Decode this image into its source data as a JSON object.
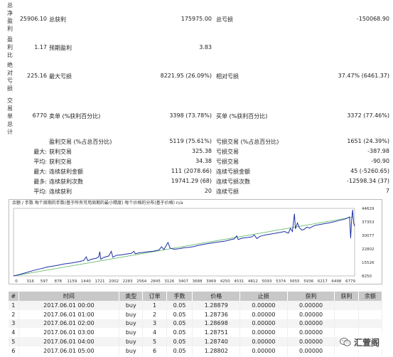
{
  "stats": {
    "net_profit": {
      "label_chars": [
        "总",
        "净",
        "盈",
        "利"
      ],
      "value": "25906.10"
    },
    "gross_profit": {
      "label": "总获利",
      "value": "175975.00"
    },
    "gross_loss": {
      "label": "总亏损",
      "value": "-150068.90"
    },
    "profit_factor": {
      "label_chars": [
        "盈",
        "利",
        "比"
      ],
      "value": "1.17"
    },
    "expected_payoff": {
      "label": "预期盈利",
      "value": "3.83"
    },
    "abs_drawdown": {
      "label_chars": [
        "绝",
        "对",
        "亏",
        "损"
      ],
      "value": "225.16"
    },
    "max_drawdown": {
      "label": "最大亏损",
      "value": "8221.95 (26.09%)"
    },
    "rel_drawdown": {
      "label": "相对亏损",
      "value": "37.47% (6461.37)"
    },
    "total_trades": {
      "label_chars": [
        "交",
        "易",
        "单",
        "总",
        "计"
      ],
      "value": "6770"
    },
    "short_positions": {
      "label": "卖单 (%获利百分比)",
      "value": "3398 (73.78%)"
    },
    "long_positions": {
      "label": "买单 (%获利百分比)",
      "value": "3372 (77.46%)"
    },
    "profit_trades": {
      "label": "盈利交易 (%占总百分比)",
      "value": "5119 (75.61%)"
    },
    "loss_trades": {
      "label": "亏损交易 (%占总百分比)",
      "value": "1651 (24.39%)"
    },
    "largest": {
      "prefix": "最大:",
      "profit_label": "获利交易",
      "profit_value": "325.38",
      "loss_label": "亏损交易",
      "loss_value": "-387.98"
    },
    "average": {
      "prefix": "平均:",
      "profit_label": "获利交易",
      "profit_value": "34.38",
      "loss_label": "亏损交易",
      "loss_value": "-90.90"
    },
    "max_consec": {
      "prefix": "最大:",
      "wins_label": "连续获利金额",
      "wins_value": "111 (2078.66)",
      "losses_label": "连续亏损金额",
      "losses_value": "45 (-5260.65)"
    },
    "most_consec": {
      "prefix": "最多:",
      "profit_label": "连续获利次数",
      "profit_value": "19741.29 (68)",
      "loss_label": "连续亏损次数",
      "loss_value": "-12598.34 (37)"
    },
    "avg_consec": {
      "prefix": "平均:",
      "wins_label": "连续获利",
      "wins_value": "20",
      "losses_label": "连续亏损",
      "losses_value": "7"
    }
  },
  "chart_header": "余额 / 手数   每个周期的手数(基于所有可用周期的最小精度)  每个价格的分布(基于价格)  n/a",
  "chart_data": {
    "type": "line",
    "series": [],
    "x_ticks": [
      "0",
      "316",
      "597",
      "878",
      "1159",
      "1440",
      "1721",
      "2002",
      "2283",
      "2564",
      "2845",
      "3126",
      "3407",
      "3688",
      "3969",
      "4250",
      "4531",
      "4812",
      "5093",
      "5374",
      "5655",
      "5936",
      "6217",
      "6498",
      "6779"
    ],
    "y_ticks": [
      "44629",
      "37353",
      "30077",
      "22802",
      "15526",
      "8250"
    ],
    "ylim": [
      8250,
      44629
    ],
    "xlim": [
      0,
      6800
    ],
    "points": [
      [
        0,
        8250
      ],
      [
        120,
        9000
      ],
      [
        250,
        10000
      ],
      [
        400,
        11200
      ],
      [
        550,
        12200
      ],
      [
        700,
        13200
      ],
      [
        850,
        13800
      ],
      [
        1000,
        14700
      ],
      [
        1150,
        15200
      ],
      [
        1300,
        15900
      ],
      [
        1400,
        16600
      ],
      [
        1450,
        18500
      ],
      [
        1480,
        16400
      ],
      [
        1550,
        17200
      ],
      [
        1650,
        17800
      ],
      [
        1700,
        18600
      ],
      [
        1720,
        21300
      ],
      [
        1740,
        17300
      ],
      [
        1800,
        18200
      ],
      [
        1900,
        19000
      ],
      [
        1950,
        21500
      ],
      [
        1980,
        18300
      ],
      [
        2050,
        19300
      ],
      [
        2150,
        19600
      ],
      [
        2250,
        20000
      ],
      [
        2350,
        20400
      ],
      [
        2400,
        21500
      ],
      [
        2430,
        20200
      ],
      [
        2500,
        20700
      ],
      [
        2600,
        21000
      ],
      [
        2700,
        21300
      ],
      [
        2800,
        21600
      ],
      [
        2900,
        22200
      ],
      [
        2950,
        23900
      ],
      [
        3000,
        22500
      ],
      [
        3080,
        26300
      ],
      [
        3120,
        23300
      ],
      [
        3200,
        22600
      ],
      [
        3300,
        22900
      ],
      [
        3400,
        23400
      ],
      [
        3500,
        23700
      ],
      [
        3600,
        24100
      ],
      [
        3700,
        24800
      ],
      [
        3800,
        25300
      ],
      [
        3900,
        25800
      ],
      [
        4000,
        26200
      ],
      [
        4100,
        26600
      ],
      [
        4200,
        26900
      ],
      [
        4300,
        27600
      ],
      [
        4400,
        28200
      ],
      [
        4450,
        29800
      ],
      [
        4480,
        27800
      ],
      [
        4550,
        28600
      ],
      [
        4650,
        28900
      ],
      [
        4750,
        29300
      ],
      [
        4800,
        30300
      ],
      [
        4850,
        28400
      ],
      [
        4920,
        29600
      ],
      [
        5000,
        30200
      ],
      [
        5100,
        30700
      ],
      [
        5200,
        31100
      ],
      [
        5300,
        31600
      ],
      [
        5400,
        32200
      ],
      [
        5480,
        31300
      ],
      [
        5520,
        33800
      ],
      [
        5560,
        32200
      ],
      [
        5600,
        41700
      ],
      [
        5620,
        33600
      ],
      [
        5660,
        36800
      ],
      [
        5700,
        34100
      ],
      [
        5750,
        33000
      ],
      [
        5800,
        33400
      ],
      [
        5850,
        34600
      ],
      [
        5900,
        34000
      ],
      [
        5950,
        34700
      ],
      [
        6000,
        35400
      ],
      [
        6100,
        35900
      ],
      [
        6200,
        36400
      ],
      [
        6300,
        36900
      ],
      [
        6400,
        37500
      ],
      [
        6500,
        38200
      ],
      [
        6600,
        38800
      ],
      [
        6650,
        39300
      ],
      [
        6700,
        40000
      ],
      [
        6720,
        28500
      ],
      [
        6740,
        38500
      ],
      [
        6760,
        43800
      ],
      [
        6780,
        36700
      ],
      [
        6800,
        35000
      ]
    ],
    "grid": false,
    "line_color": "#1c2fa8"
  },
  "table": {
    "headers": [
      "#",
      "时间",
      "类型",
      "订单",
      "手数",
      "价格",
      "止损",
      "获利",
      "获利",
      "余额"
    ],
    "rows": [
      [
        "1",
        "2017.06.01 00:00",
        "buy",
        "1",
        "0.05",
        "1.28879",
        "0.00000",
        "0.00000",
        "",
        ""
      ],
      [
        "2",
        "2017.06.01 01:00",
        "buy",
        "2",
        "0.05",
        "1.28736",
        "0.00000",
        "0.00000",
        "",
        ""
      ],
      [
        "3",
        "2017.06.01 02:00",
        "buy",
        "3",
        "0.05",
        "1.28698",
        "0.00000",
        "0.00000",
        "",
        ""
      ],
      [
        "4",
        "2017.06.01 03:00",
        "buy",
        "4",
        "0.05",
        "1.28751",
        "0.00000",
        "0.00000",
        "",
        ""
      ],
      [
        "5",
        "2017.06.01 04:00",
        "buy",
        "5",
        "0.05",
        "1.28740",
        "0.00000",
        "0.00000",
        "",
        ""
      ],
      [
        "6",
        "2017.06.01 05:00",
        "buy",
        "6",
        "0.05",
        "1.28802",
        "0.00000",
        "0.00000",
        "",
        ""
      ]
    ]
  },
  "watermark": {
    "text": "汇萱阁",
    "icon": "wechat-icon"
  }
}
